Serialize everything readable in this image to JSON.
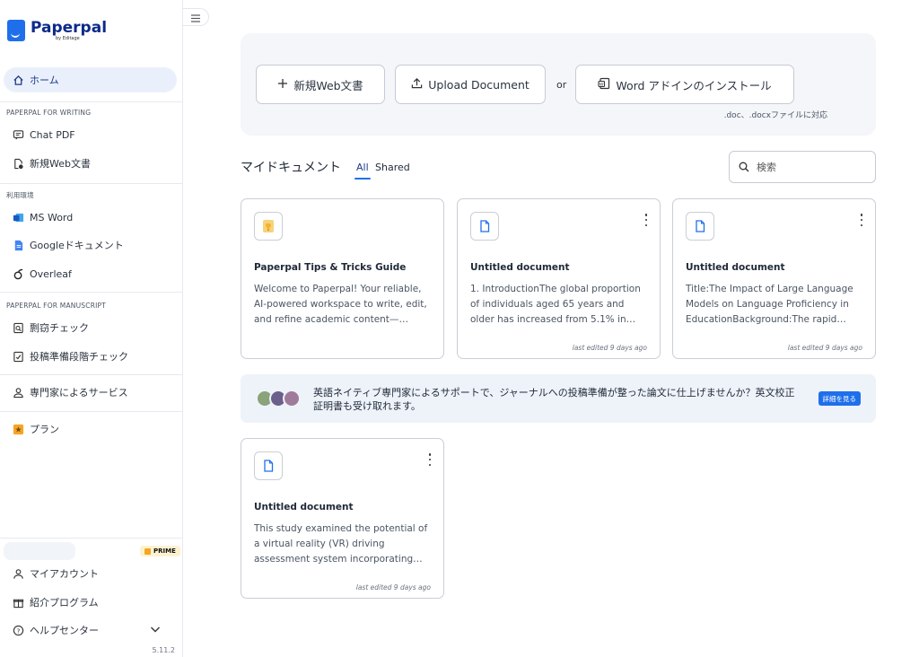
{
  "brand": {
    "name": "Paperpal",
    "sub": "by Editage"
  },
  "sidebar": {
    "home": "ホーム",
    "section_writing": "PAPERPAL FOR WRITING",
    "chat_pdf": "Chat PDF",
    "new_web_doc": "新規Web文書",
    "section_env": "利用環境",
    "ms_word": "MS Word",
    "google_docs": "Googleドキュメント",
    "overleaf": "Overleaf",
    "section_manuscript": "PAPERPAL FOR MANUSCRIPT",
    "plagiarism": "剽窃チェック",
    "submission_check": "投稿準備段階チェック",
    "expert_services": "専門家によるサービス",
    "plan": "プラン",
    "prime_badge": "PRIME",
    "my_account": "マイアカウント",
    "referral": "紹介プログラム",
    "help_center": "ヘルプセンター",
    "version": "5.11.2"
  },
  "upload": {
    "new_web_doc": "新規Web文書",
    "upload_document": "Upload Document",
    "or": "or",
    "word_addin": "Word アドインのインストール",
    "support_note": ".doc、.docxファイルに対応"
  },
  "docs": {
    "header": "マイドキュメント",
    "tab_all": "All",
    "tab_shared": "Shared",
    "search_placeholder": "検索",
    "cards": [
      {
        "title": "Paperpal Tips & Tricks Guide",
        "desc": "Welcome to Paperpal! Your reliable, AI-powered workspace to write, edit, and refine academic content—faster…",
        "edited": ""
      },
      {
        "title": "Untitled document",
        "desc": "1. IntroductionThe global proportion of individuals aged 65 years and older has increased from 5.1% in 1950 to…",
        "edited": "last edited 9 days ago"
      },
      {
        "title": "Untitled document",
        "desc": "Title:The Impact of Large Language Models on Language Proficiency in EducationBackground:The rapid…",
        "edited": "last edited 9 days ago"
      },
      {
        "title": "Untitled document",
        "desc": "This study examined the potential of a virtual reality (VR) driving assessment system incorporating eye-tracking…",
        "edited": "last edited 9 days ago"
      }
    ]
  },
  "promo": {
    "text": "英語ネイティブ専門家によるサポートで、ジャーナルへの投稿準備が整った論文に仕上げませんか？英文校正証明書も受け取れます。",
    "button": "詳細を見る"
  },
  "colors": {
    "accent": "#1f6feb",
    "brand": "#0b2a8a",
    "panel": "#f4f6fa",
    "promo": "#eef3fa"
  }
}
